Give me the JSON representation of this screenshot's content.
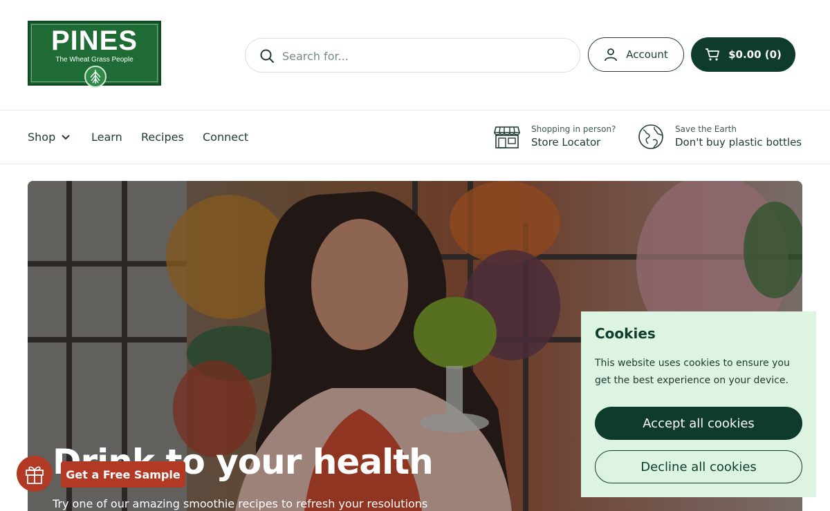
{
  "logo": {
    "name": "PINES",
    "tagline": "The Wheat Grass People"
  },
  "search": {
    "placeholder": "Search for..."
  },
  "header": {
    "account_label": "Account",
    "cart_label": "$0.00 (0)"
  },
  "nav": {
    "items": [
      {
        "label": "Shop"
      },
      {
        "label": "Learn"
      },
      {
        "label": "Recipes"
      },
      {
        "label": "Connect"
      }
    ],
    "store": {
      "sub": "Shopping in person?",
      "main": "Store Locator"
    },
    "earth": {
      "sub": "Save the Earth",
      "main": "Don't buy plastic bottles"
    }
  },
  "hero": {
    "title": "Drink to your health",
    "subtitle": "Try one of our amazing smoothie recipes to refresh your resolutions"
  },
  "cookies": {
    "title": "Cookies",
    "text": "This website uses cookies to ensure you get the best experience on your device.",
    "accept_label": "Accept all cookies",
    "decline_label": "Decline all cookies"
  },
  "sample": {
    "label": "Get a Free Sample"
  },
  "colors": {
    "brand_dark": "#0f3b2c",
    "logo_green": "#1e6b35",
    "cookie_bg": "#ddf4e2",
    "sample_red": "#b23a25"
  }
}
